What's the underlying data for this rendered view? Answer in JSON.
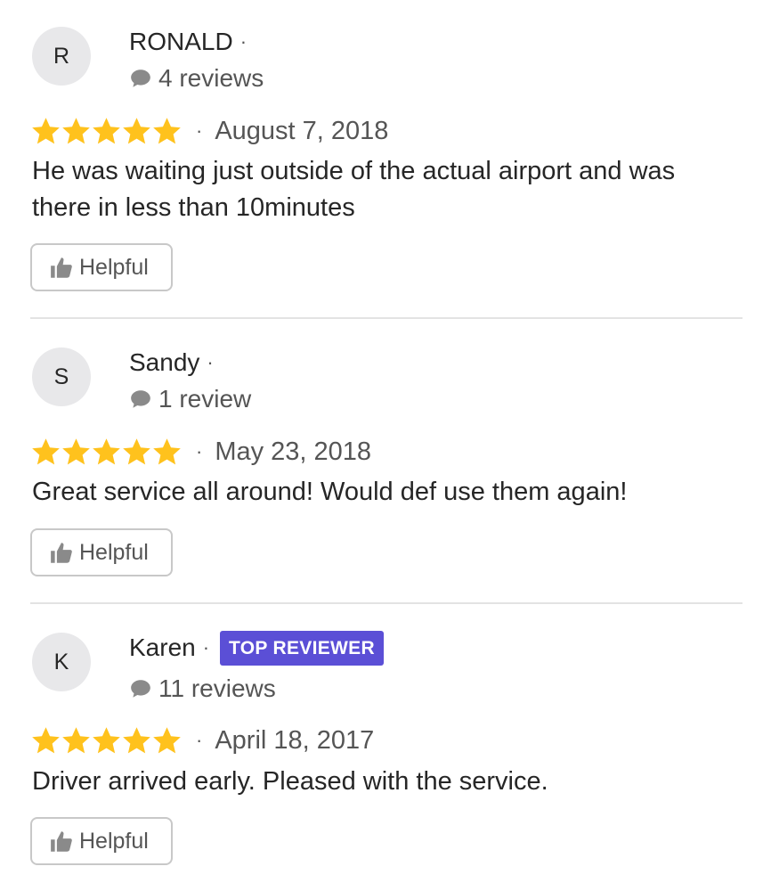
{
  "colors": {
    "star": "#ffc21d",
    "badge_bg": "#5b4fd6",
    "icon_gray": "#8a8a8a",
    "text_dark": "#262626",
    "text_muted": "#555555"
  },
  "reviews": [
    {
      "initial": "R",
      "name": "RONALD",
      "name_separator": "·",
      "badge": "",
      "review_count": "4 reviews",
      "rating": 5,
      "rating_separator": "·",
      "date": "August 7, 2018",
      "text": "He was waiting just outside of the actual airport and was there in less than 10minutes",
      "helpful_label": "Helpful"
    },
    {
      "initial": "S",
      "name": "Sandy",
      "name_separator": "·",
      "badge": "",
      "review_count": "1 review",
      "rating": 5,
      "rating_separator": "·",
      "date": "May 23, 2018",
      "text": "Great service all around! Would def use them again!",
      "helpful_label": "Helpful"
    },
    {
      "initial": "K",
      "name": "Karen",
      "name_separator": "·",
      "badge": "TOP REVIEWER",
      "review_count": "11 reviews",
      "rating": 5,
      "rating_separator": "·",
      "date": "April 18, 2017",
      "text": "Driver arrived early. Pleased with the service.",
      "helpful_label": "Helpful"
    }
  ],
  "icons": {
    "review_count": "speech-bubble-icon",
    "rating": "star-icon",
    "helpful": "thumbs-up-icon"
  }
}
